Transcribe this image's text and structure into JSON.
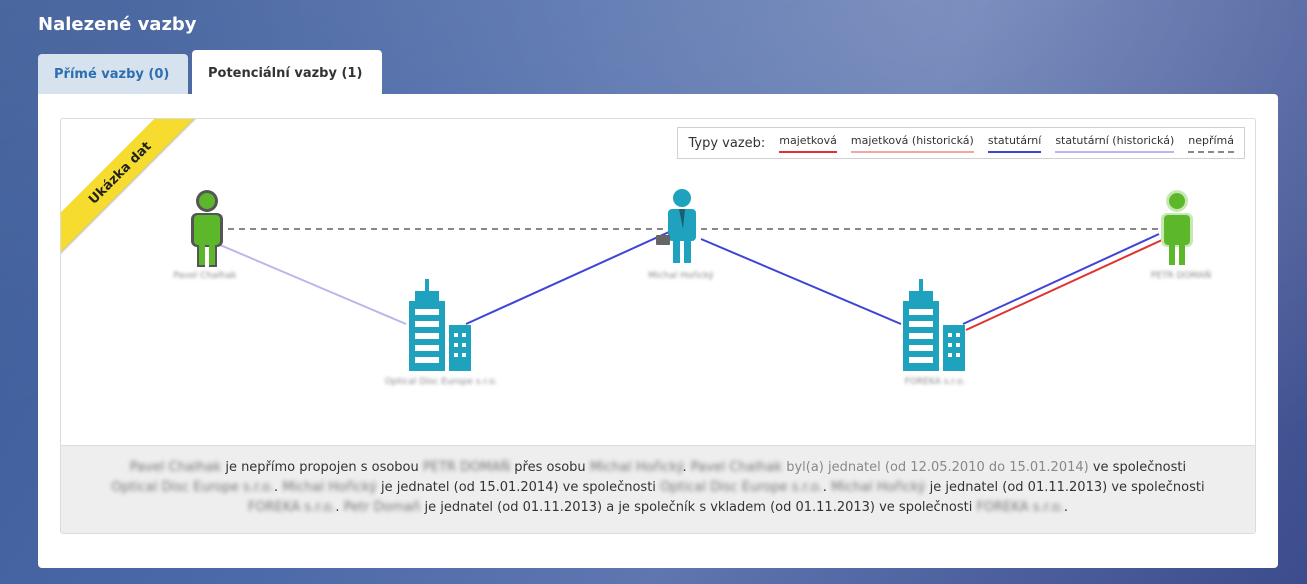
{
  "section_title": "Nalezené vazby",
  "tabs": [
    {
      "label": "Přímé vazby (0)",
      "active": false
    },
    {
      "label": "Potenciální vazby (1)",
      "active": true
    }
  ],
  "ribbon": "Ukázka dat",
  "legend": {
    "title": "Typy vazeb:",
    "items": [
      {
        "label": "majetková",
        "color": "#e0322f",
        "style": "solid"
      },
      {
        "label": "majetková (historická)",
        "color": "#f2a6a0",
        "style": "solid"
      },
      {
        "label": "statutární",
        "color": "#3f43d6",
        "style": "solid"
      },
      {
        "label": "statutární (historická)",
        "color": "#b8b8ea",
        "style": "solid"
      },
      {
        "label": "nepřímá",
        "color": "#888888",
        "style": "dashed"
      }
    ]
  },
  "nodes": [
    {
      "id": "p1",
      "kind": "person",
      "color": "#5cb82a",
      "label": "Pavel Chalhak"
    },
    {
      "id": "c1",
      "kind": "company",
      "color": "#1fa2bd",
      "label": "Optical Disc Europe s.r.o."
    },
    {
      "id": "p2",
      "kind": "businessman",
      "color": "#1fa2bd",
      "label": "Michal Hořický"
    },
    {
      "id": "c2",
      "kind": "company",
      "color": "#1fa2bd",
      "label": "FOREKA s.r.o."
    },
    {
      "id": "p3",
      "kind": "person",
      "color": "#5cb82a",
      "label": "PETR DOMAŇ"
    }
  ],
  "footer": {
    "line1": {
      "name_a": "Pavel Chalhak",
      "t1": "je nepřímo propojen s osobou",
      "name_b": "PETR DOMAŇ",
      "t2": "přes osobu",
      "name_c": "Michal Hořický",
      "name_d": "Pavel Chalhak",
      "t3": "byl(a) jednatel (od 12.05.2010 do 15.01.2014)",
      "t4": "ve společnosti"
    },
    "line2": {
      "company_a": "Optical Disc Europe s.r.o.",
      "name_e": "Michal Hořický",
      "t1": "je jednatel (od 15.01.2014) ve společnosti",
      "company_b": "Optical Disc Europe s.r.o.",
      "name_f": "Michal Hořický",
      "t2": "je jednatel (od 01.11.2013) ve společnosti"
    },
    "line3": {
      "company_c": "FOREKA s.r.o.",
      "name_g": "Petr Domaň",
      "t1": "je jednatel (od 01.11.2013) a je společník s vkladem (od 01.11.2013) ve společnosti",
      "company_d": "FOREKA s.r.o."
    }
  }
}
